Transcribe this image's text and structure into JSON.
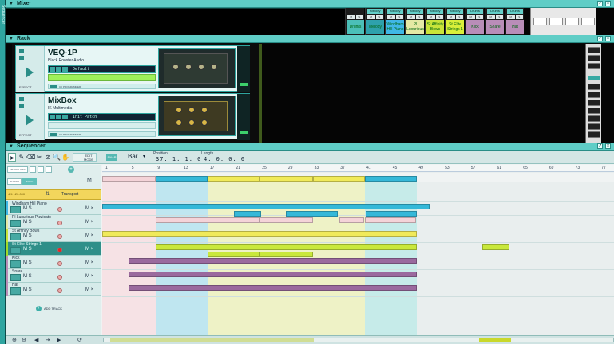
{
  "colors": {
    "accent": "#5fcdc6",
    "accent_dark": "#2a8d87",
    "lime": "#c9e83b",
    "cyan_clip": "#35b8d8",
    "yellow_clip": "#f0ea5a",
    "purple_clip": "#9a6a9e",
    "teal_clip": "#52c7c1"
  },
  "window": {
    "side_label": "Sequencer"
  },
  "mixer": {
    "title": "Mixer",
    "channels": [
      {
        "name": "Drums",
        "tag": "",
        "color": "#4bbfb8"
      },
      {
        "name": "Melody",
        "tag": "Melody",
        "color": "#2ea1ac"
      },
      {
        "name": "Windham Hill Piano",
        "tag": "Melody",
        "color": "#3fb7e6"
      },
      {
        "name": "Pl Luxurious",
        "tag": "Melody",
        "color": "#e4e9a4"
      },
      {
        "name": "St Affinity Bows",
        "tag": "Melody",
        "color": "#c9e43a"
      },
      {
        "name": "St Elite Strings 1",
        "tag": "Melody",
        "color": "#d9ef3a"
      },
      {
        "name": "Kick",
        "tag": "Drums",
        "color": "#b98db8"
      },
      {
        "name": "Snare",
        "tag": "Drums",
        "color": "#b98db8"
      },
      {
        "name": "Hat",
        "tag": "Drums",
        "color": "#b98db8"
      }
    ],
    "sm_label": "M S"
  },
  "rack": {
    "title": "Rack",
    "devices": [
      {
        "name": "VEQ-1P",
        "vendor": "Black Rooster Audio",
        "preset": "Default",
        "effect_label": "EFFECT",
        "prog_label": "CV PROGRAMMER"
      },
      {
        "name": "MixBox",
        "vendor": "IK Multimedia",
        "preset": "Init Patch",
        "effect_label": "EFFECT",
        "prog_label": "CV PROGRAMMER"
      }
    ]
  },
  "sequencer": {
    "title": "Sequencer",
    "snap_label": "SNAP",
    "snap_value": "Bar",
    "position_label": "Position",
    "position_value": "37. 1. 1.   0",
    "length_label": "Length",
    "length_value": "4. 0. 0.   0",
    "edit_mode_label": "EDIT MODE",
    "manual_rec_label": "MANUAL REC",
    "blocks_label": "BLOCKS",
    "song_label": "SONG",
    "m_label": "M",
    "transport_label": "Transport",
    "time_sig": "4/4 120.000",
    "add_track_label": "ADD TRACK",
    "ruler": [
      "1",
      "5",
      "9",
      "13",
      "17",
      "21",
      "25",
      "29",
      "33",
      "37",
      "41",
      "45",
      "49",
      "53",
      "57",
      "61",
      "65",
      "69",
      "73",
      "77"
    ],
    "tracks": [
      {
        "name": "Windham Hill Piano",
        "color": "#3fb7e6"
      },
      {
        "name": "Pl Luxurious Pizzicato",
        "color": "#e4e9a4"
      },
      {
        "name": "St Affinity Bows",
        "color": "#c9e43a"
      },
      {
        "name": "St Elite Strings 1",
        "color": "#9edb2a"
      },
      {
        "name": "Kick",
        "color": "#b98db8"
      },
      {
        "name": "Snare",
        "color": "#b98db8"
      },
      {
        "name": "Hat",
        "color": "#b98db8"
      }
    ],
    "ms_label": "M S",
    "mx_label": "M ×"
  }
}
